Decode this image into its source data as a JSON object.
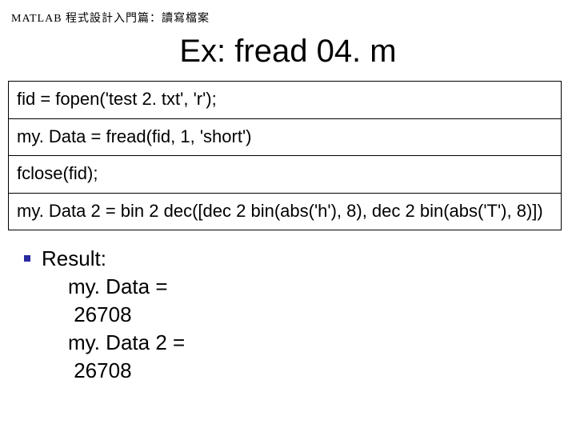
{
  "header": {
    "caption": "MATLAB 程式設計入門篇：讀寫檔案"
  },
  "title": "Ex: fread 04. m",
  "code": {
    "line1": "fid = fopen('test 2. txt', 'r');",
    "line2": "my. Data = fread(fid, 1, 'short')",
    "line3": "fclose(fid);",
    "line4": "my. Data 2 = bin 2 dec([dec 2 bin(abs('h'), 8), dec 2 bin(abs('T'), 8)])"
  },
  "result": {
    "label": "Result:",
    "line1": "my. Data =",
    "val1": " 26708",
    "line2": "my. Data 2 =",
    "val2": " 26708"
  }
}
